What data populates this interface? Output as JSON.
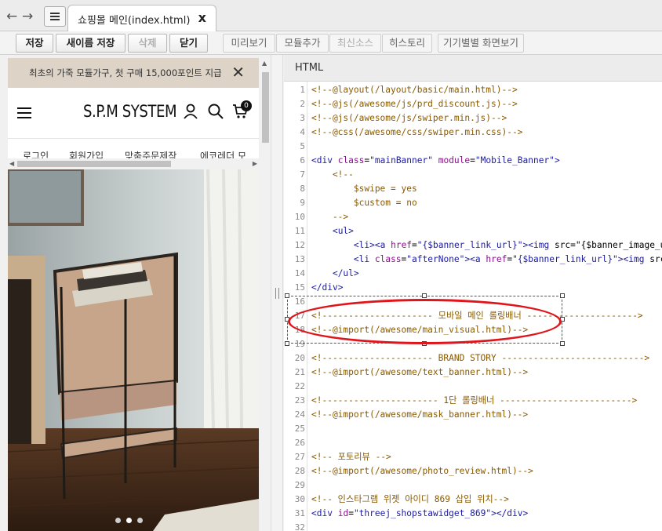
{
  "tabbar": {
    "back_glyph": "←",
    "forward_glyph": "→",
    "doc_tab_title": "쇼핑몰 메인(index.html)",
    "close_glyph": "x"
  },
  "toolbar": {
    "save": "저장",
    "save_as": "새이름 저장",
    "delete": "삭제",
    "close": "닫기",
    "preview": "미리보기",
    "add_module": "모듈추가",
    "latest_source": "최신소스",
    "history": "히스토리",
    "device_view": "기기별별 화면보기"
  },
  "preview": {
    "promo_text": "최초의 가죽 모듈가구, 첫 구매 15,000포인트 지급",
    "logo": "S.P.M SYSTEM",
    "cart_count": "0",
    "subnav": [
      "로그인",
      "회원가입",
      "맞춤주문제작",
      "에코레더 모"
    ]
  },
  "editor": {
    "label": "HTML",
    "lines": [
      {
        "n": "1",
        "t": "<!--@layout(/layout/basic/main.html)-->"
      },
      {
        "n": "2",
        "t": "<!--@js(/awesome/js/prd_discount.js)-->"
      },
      {
        "n": "3",
        "t": "<!--@js(/awesome/js/swiper.min.js)-->"
      },
      {
        "n": "4",
        "t": "<!--@css(/awesome/css/swiper.min.css)-->"
      },
      {
        "n": "5",
        "t": ""
      },
      {
        "n": "6",
        "t": "<div class=\"mainBanner\" module=\"Mobile_Banner\">"
      },
      {
        "n": "7",
        "t": "    <!--"
      },
      {
        "n": "8",
        "t": "        $swipe = yes"
      },
      {
        "n": "9",
        "t": "        $custom = no"
      },
      {
        "n": "10",
        "t": "    -->"
      },
      {
        "n": "11",
        "t": "    <ul>"
      },
      {
        "n": "12",
        "t": "        <li><a href=\"{$banner_link_url}\"><img src=\"{$banner_image_url}"
      },
      {
        "n": "13",
        "t": "        <li class=\"afterNone\"><a href=\"{$banner_link_url}\"><img src=\"{"
      },
      {
        "n": "14",
        "t": "    </ul>"
      },
      {
        "n": "15",
        "t": "</div>"
      },
      {
        "n": "16",
        "t": ""
      },
      {
        "n": "17",
        "t": "<!--------------------- 모바일 메인 롤링배너 --------------------->"
      },
      {
        "n": "18",
        "t": "<!--@import(/awesome/main_visual.html)-->"
      },
      {
        "n": "19",
        "t": ""
      },
      {
        "n": "20",
        "t": "<!--------------------- BRAND STORY --------------------------->"
      },
      {
        "n": "21",
        "t": "<!--@import(/awesome/text_banner.html)-->"
      },
      {
        "n": "22",
        "t": ""
      },
      {
        "n": "23",
        "t": "<!---------------------- 1단 롤링배너 ------------------------->"
      },
      {
        "n": "24",
        "t": "<!--@import(/awesome/mask_banner.html)-->"
      },
      {
        "n": "25",
        "t": ""
      },
      {
        "n": "26",
        "t": ""
      },
      {
        "n": "27",
        "t": "<!-- 포토리뷰 -->"
      },
      {
        "n": "28",
        "t": "<!--@import(/awesome/photo_review.html)-->"
      },
      {
        "n": "29",
        "t": ""
      },
      {
        "n": "30",
        "t": "<!-- 인스타그램 위젯 아이디 869 삽입 위치-->"
      },
      {
        "n": "31",
        "t": "<div id=\"threej_shopstawidget_869\"></div>"
      },
      {
        "n": "32",
        "t": ""
      }
    ]
  }
}
